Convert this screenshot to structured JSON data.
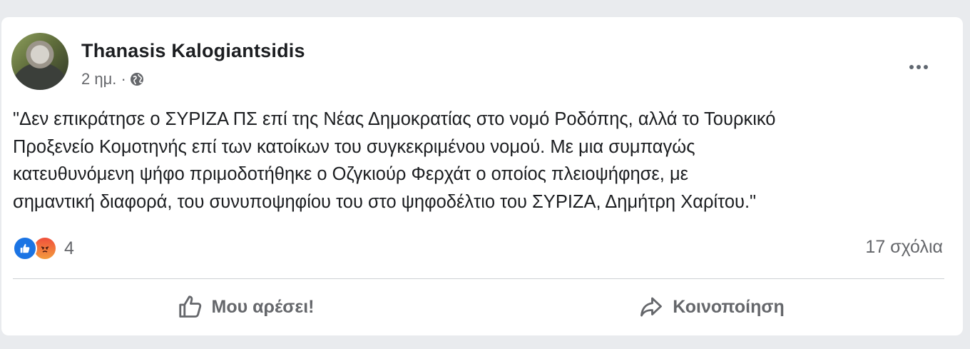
{
  "post": {
    "author": "Thanasis Kalogiantsidis",
    "time": "2 ημ. ·",
    "privacy_icon": "globe-icon",
    "more_icon": "more-options-icon",
    "text": "\"Δεν επικράτησε ο ΣΥΡΙΖΑ ΠΣ επί της Νέας Δημοκρατίας στο νομό Ροδόπης, αλλά το Τουρκικό\nΠροξενείο Κομοτηνής επί των κατοίκων του συγκεκριμένου νομού. Με μια συμπαγώς\nκατευθυνόμενη ψήφο πριμοδοτήθηκε ο Οζγκιούρ Φερχάτ ο οποίος πλειοψήφησε, με\nσημαντική διαφορά, του συνυποψηφίου του στο ψηφοδέλτιο του ΣΥΡΙΖΑ, Δημήτρη Χαρίτου.\"",
    "reactions": {
      "icons": [
        "like-reaction-icon",
        "angry-reaction-icon"
      ],
      "count": "4"
    },
    "comments": "17 σχόλια",
    "actions": {
      "like_label": "Μου αρέσει!",
      "share_label": "Κοινοποίηση"
    }
  },
  "colors": {
    "background": "#e9ebee",
    "card": "#ffffff",
    "text": "#1c1e21",
    "secondary_text": "#65676b",
    "like_blue": "#1b74e4"
  }
}
